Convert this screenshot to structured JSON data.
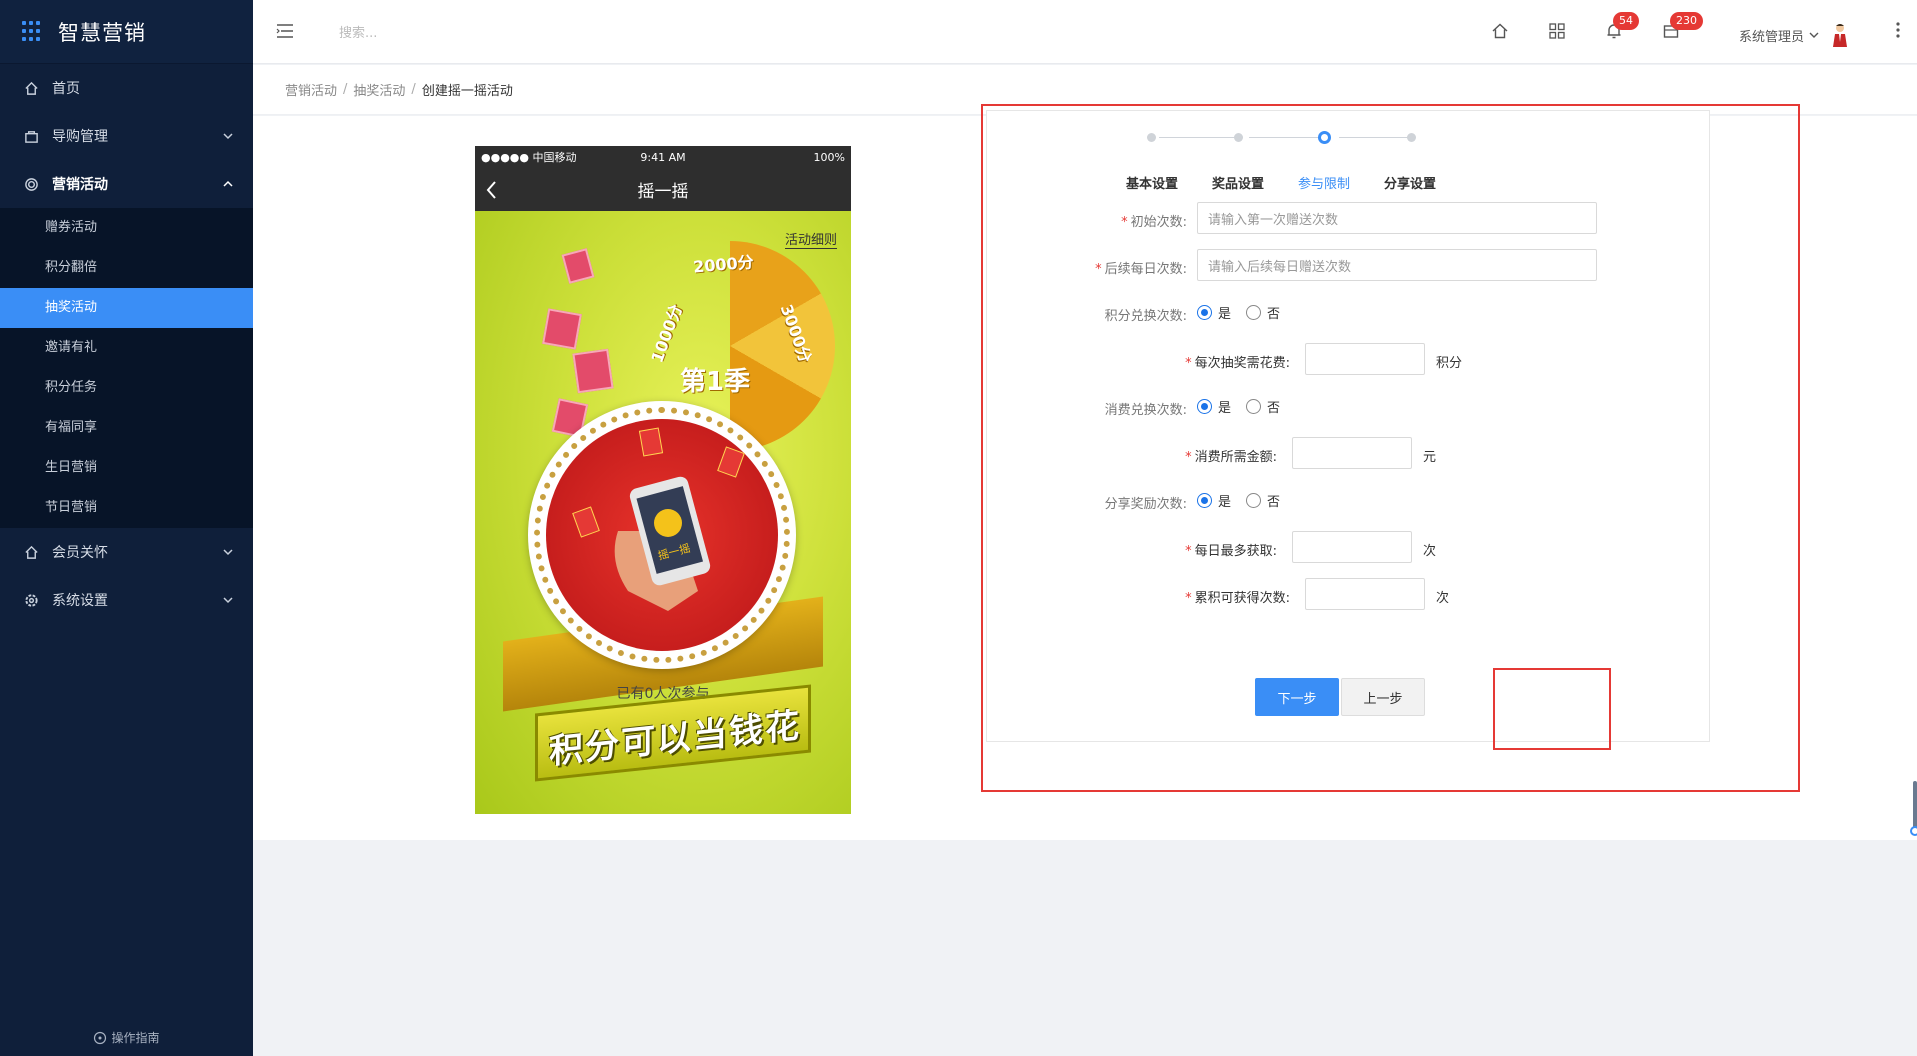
{
  "app": {
    "title": "智慧营销"
  },
  "sidebar": {
    "items": [
      {
        "label": "首页",
        "icon": "home-icon"
      },
      {
        "label": "导购管理",
        "icon": "bag-icon"
      },
      {
        "label": "营销活动",
        "icon": "target-icon",
        "open": true,
        "children": [
          {
            "label": "赠券活动"
          },
          {
            "label": "积分翻倍"
          },
          {
            "label": "抽奖活动",
            "active": true
          },
          {
            "label": "邀请有礼"
          },
          {
            "label": "积分任务"
          },
          {
            "label": "有福同享"
          },
          {
            "label": "生日营销"
          },
          {
            "label": "节日营销"
          }
        ]
      },
      {
        "label": "会员关怀",
        "icon": "home-icon"
      },
      {
        "label": "系统设置",
        "icon": "gear-icon"
      }
    ],
    "guide": "操作指南"
  },
  "header": {
    "search_placeholder": "搜索...",
    "notifications_count": "54",
    "messages_count": "230",
    "user_name": "系统管理员"
  },
  "breadcrumb": [
    "营销活动",
    "抽奖活动",
    "创建摇一摇活动"
  ],
  "phone": {
    "carrier": "●●●●● 中国移动",
    "time": "9:41 AM",
    "battery": "100%",
    "title": "摇一摇",
    "rules_link": "活动细则",
    "wheel_labels": [
      "1000分",
      "2000分",
      "3000分"
    ],
    "season": "第1季",
    "phone_text": "摇一摇",
    "participants": "已有0人次参与",
    "slogan": "积分可以当钱花"
  },
  "steps": [
    {
      "label": "基本设置",
      "active": false
    },
    {
      "label": "奖品设置",
      "active": false
    },
    {
      "label": "参与限制",
      "active": true
    },
    {
      "label": "分享设置",
      "active": false
    }
  ],
  "form": {
    "initial_times": {
      "label": "初始次数:",
      "placeholder": "请输入第一次赠送次数"
    },
    "daily_times": {
      "label": "后续每日次数:",
      "placeholder": "请输入后续每日赠送次数"
    },
    "points_exchange": {
      "label": "积分兑换次数:",
      "yes": "是",
      "no": "否",
      "value": "是"
    },
    "points_cost": {
      "label": "每次抽奖需花费:",
      "unit": "积分"
    },
    "spend_exchange": {
      "label": "消费兑换次数:",
      "yes": "是",
      "no": "否",
      "value": "是"
    },
    "spend_amount": {
      "label": "消费所需金额:",
      "unit": "元"
    },
    "share_reward": {
      "label": "分享奖励次数:",
      "yes": "是",
      "no": "否",
      "value": "是"
    },
    "daily_max": {
      "label": "每日最多获取:",
      "unit": "次"
    },
    "total_max": {
      "label": "累积可获得次数:",
      "unit": "次"
    }
  },
  "buttons": {
    "next": "下一步",
    "prev": "上一步"
  },
  "colors": {
    "sidebar_bg": "#0f1f3a",
    "accent": "#3a8ef6",
    "highlight": "#e53935"
  }
}
